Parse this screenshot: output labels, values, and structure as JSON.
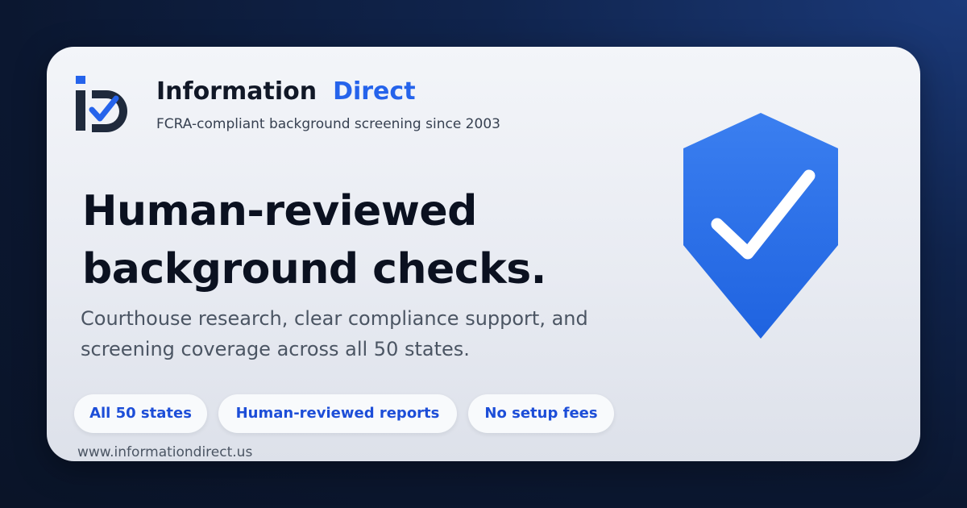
{
  "brand": {
    "name_part1": "Information",
    "name_part2": "Direct",
    "tagline": "FCRA-compliant background screening since 2003",
    "logo_icon": "id-check-logo-icon",
    "accent_color": "#2563eb"
  },
  "hero": {
    "headline_line1": "Human-reviewed",
    "headline_line2": "background checks.",
    "subtext_line1": "Courthouse research, clear compliance support, and",
    "subtext_line2": "screening coverage across all 50 states."
  },
  "features": [
    {
      "label": "All 50 states"
    },
    {
      "label": "Human-reviewed reports"
    },
    {
      "label": "No setup fees"
    }
  ],
  "footer": {
    "url": "www.informationdirect.us"
  },
  "illustration": {
    "icon": "shield-check-icon",
    "color": "#2b6fe8"
  }
}
